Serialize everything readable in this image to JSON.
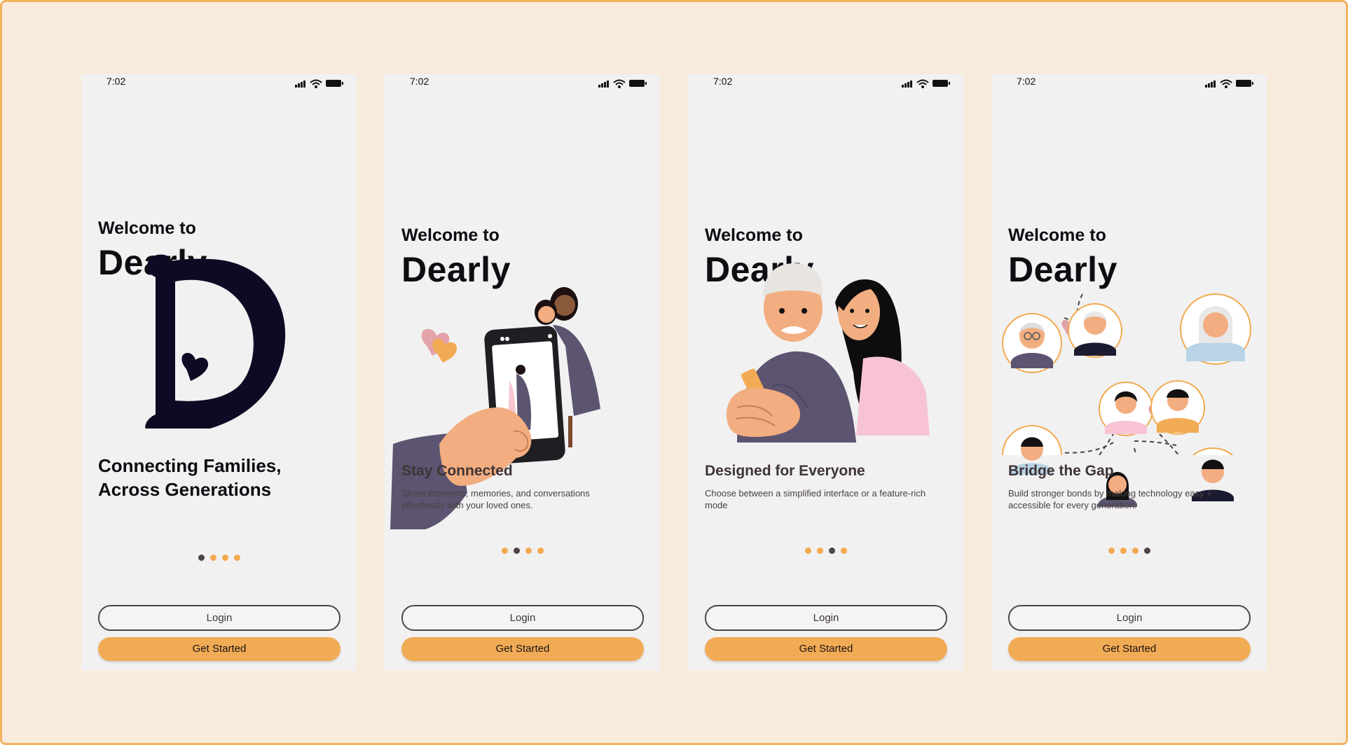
{
  "colors": {
    "accent": "#f2a94e",
    "dark": "#0f0a24",
    "text": "#0d0d12",
    "background": "#f9ebdb",
    "screen": "#f1f1f2"
  },
  "screens": [
    {
      "time": "7:02",
      "welcome": "Welcome to",
      "brand": "Dearly",
      "tagline": "Connecting Families, Across Generations",
      "title": "",
      "description": "",
      "active_dot": 0,
      "login": "Login",
      "get_started": "Get Started",
      "illustration": "dearly-d-logo"
    },
    {
      "time": "7:02",
      "welcome": "Welcome to",
      "brand": "Dearly",
      "tagline": "",
      "title": "Stay Connected",
      "description": "Share moments, memories, and conversations effortlessly with your loved ones.",
      "active_dot": 1,
      "login": "Login",
      "get_started": "Get Started",
      "illustration": "hand-holding-phone-photo"
    },
    {
      "time": "7:02",
      "welcome": "Welcome to",
      "brand": "Dearly",
      "tagline": "",
      "title": "Designed for Everyone",
      "description": "Choose between a simplified interface or a feature-rich mode",
      "active_dot": 2,
      "login": "Login",
      "get_started": "Get Started",
      "illustration": "grandfather-granddaughter-phone"
    },
    {
      "time": "7:02",
      "welcome": "Welcome to",
      "brand": "Dearly",
      "tagline": "",
      "title": "Bridge the Gap",
      "description": "Build stronger bonds by making technology easy + accessible for every generation.",
      "active_dot": 3,
      "login": "Login",
      "get_started": "Get Started",
      "illustration": "family-network-avatars"
    }
  ]
}
